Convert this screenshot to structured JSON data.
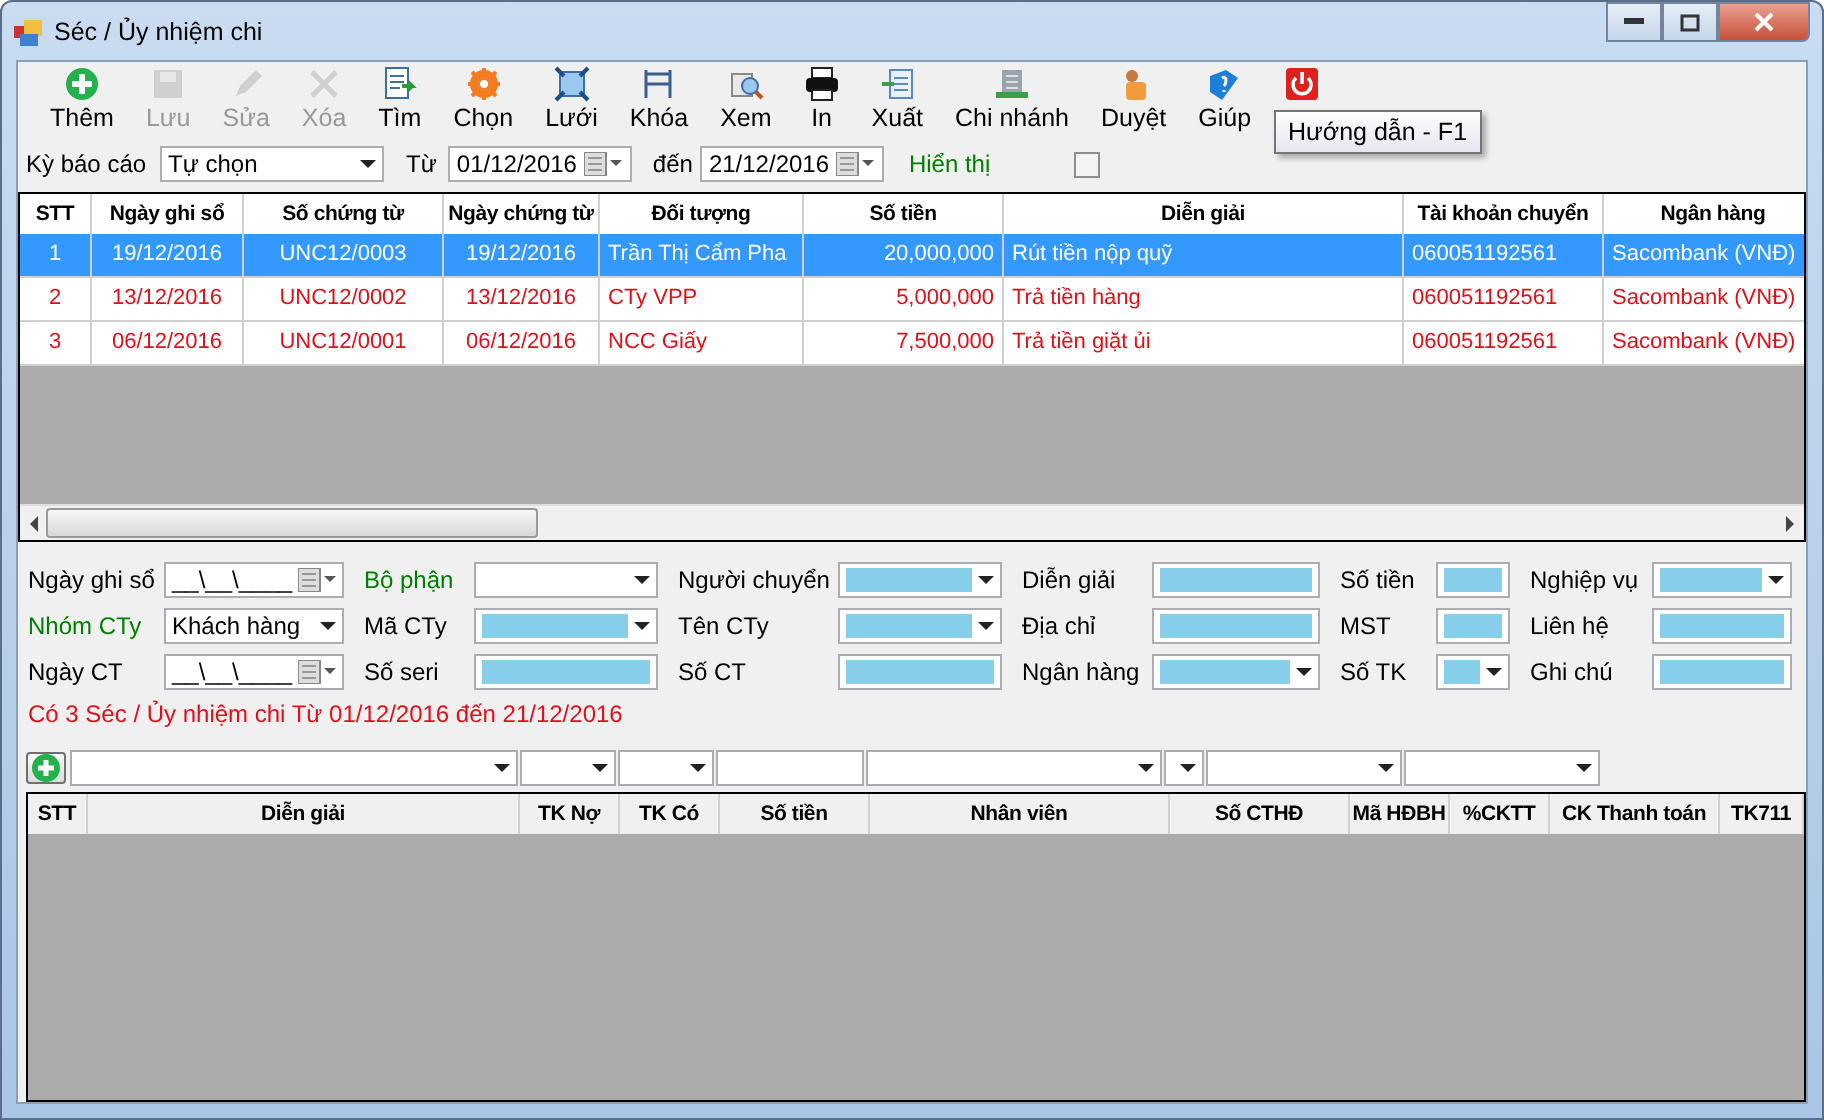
{
  "window": {
    "title": "Séc / Ủy nhiệm chi"
  },
  "toolbar": [
    {
      "label": "Thêm",
      "disabled": false
    },
    {
      "label": "Lưu",
      "disabled": true
    },
    {
      "label": "Sửa",
      "disabled": true
    },
    {
      "label": "Xóa",
      "disabled": true
    },
    {
      "label": "Tìm",
      "disabled": false
    },
    {
      "label": "Chọn",
      "disabled": false
    },
    {
      "label": "Lưới",
      "disabled": false
    },
    {
      "label": "Khóa",
      "disabled": false
    },
    {
      "label": "Xem",
      "disabled": false
    },
    {
      "label": "In",
      "disabled": false
    },
    {
      "label": "Xuất",
      "disabled": false
    },
    {
      "label": "Chi nhánh",
      "disabled": false
    },
    {
      "label": "Duyệt",
      "disabled": false
    },
    {
      "label": "Giúp",
      "disabled": false
    },
    {
      "disabled": false
    }
  ],
  "tooltip": "Hướng dẫn - F1",
  "filter": {
    "period_label": "Kỳ báo cáo",
    "period": "Tự chọn",
    "from_label": "Từ",
    "from": "01/12/2016",
    "to_label": "đến",
    "to": "21/12/2016",
    "show_label": "Hiển thị",
    "show_checked": false
  },
  "table": {
    "columns": [
      "STT",
      "Ngày ghi sổ",
      "Số chứng từ",
      "Ngày chứng từ",
      "Đối tượng",
      "Số tiền",
      "Diễn giải",
      "Tài khoản chuyển",
      "Ngân hàng"
    ],
    "rows": [
      {
        "selected": true,
        "cells": [
          "1",
          "19/12/2016",
          "UNC12/0003",
          "19/12/2016",
          "Trần Thị Cẩm Pha",
          "20,000,000",
          "Rút tiền nộp quỹ",
          "060051192561",
          "Sacombank (VNĐ)"
        ]
      },
      {
        "selected": false,
        "cells": [
          "2",
          "13/12/2016",
          "UNC12/0002",
          "13/12/2016",
          "CTy VPP",
          "5,000,000",
          "Trả tiền hàng",
          "060051192561",
          "Sacombank (VNĐ)"
        ]
      },
      {
        "selected": false,
        "cells": [
          "3",
          "06/12/2016",
          "UNC12/0001",
          "06/12/2016",
          "NCC Giấy",
          "7,500,000",
          "Trả tiền giặt ủi",
          "060051192561",
          "Sacombank (VNĐ)"
        ]
      }
    ]
  },
  "form": [
    [
      {
        "label": "Ngày ghi sổ",
        "kind": "date",
        "value": "__\\__\\____",
        "filled": false
      },
      {
        "label": "Bộ phận",
        "color": "#008000",
        "kind": "combo",
        "filled": false
      },
      {
        "label": "Người chuyển",
        "kind": "combo",
        "filled": true
      },
      {
        "label": "Diễn giải",
        "kind": "text",
        "filled": true
      },
      {
        "label": "Số tiền",
        "kind": "text",
        "filled": true
      },
      {
        "label": "Nghiệp vụ",
        "kind": "combo",
        "filled": true
      }
    ],
    [
      {
        "label": "Nhóm CTy",
        "color": "#008000",
        "kind": "combo",
        "value": "Khách hàng",
        "filled": false
      },
      {
        "label": "Mã CTy",
        "kind": "combo",
        "filled": true
      },
      {
        "label": "Tên CTy",
        "kind": "combo",
        "filled": true
      },
      {
        "label": "Địa chỉ",
        "kind": "text",
        "filled": true
      },
      {
        "label": "MST",
        "kind": "text",
        "filled": true
      },
      {
        "label": "Liên hệ",
        "kind": "text",
        "filled": true
      }
    ],
    [
      {
        "label": "Ngày CT",
        "kind": "date",
        "value": "__\\__\\____",
        "filled": false
      },
      {
        "label": "Số seri",
        "kind": "text",
        "filled": true
      },
      {
        "label": "Số CT",
        "kind": "text",
        "filled": true
      },
      {
        "label": "Ngân hàng",
        "kind": "combo",
        "filled": true
      },
      {
        "label": "Số TK",
        "kind": "combo",
        "filled": true
      },
      {
        "label": "Ghi chú",
        "kind": "text",
        "filled": true
      }
    ]
  ],
  "summary": "Có 3 Séc / Ủy nhiệm chi Từ 01/12/2016 đến 21/12/2016",
  "detail": {
    "filters": [
      {
        "kind": "combo"
      },
      {
        "kind": "combo"
      },
      {
        "kind": "combo"
      },
      {
        "kind": "text"
      },
      {
        "kind": "combo"
      },
      {
        "kind": "combo"
      },
      {
        "kind": "combo"
      },
      {
        "kind": "combo"
      }
    ],
    "columns": [
      "STT",
      "Diễn giải",
      "TK Nợ",
      "TK Có",
      "Số tiền",
      "Nhân viên",
      "Số CTHĐ",
      "Mã HĐBH",
      "%CKTT",
      "CK Thanh toán",
      "TK711"
    ]
  }
}
